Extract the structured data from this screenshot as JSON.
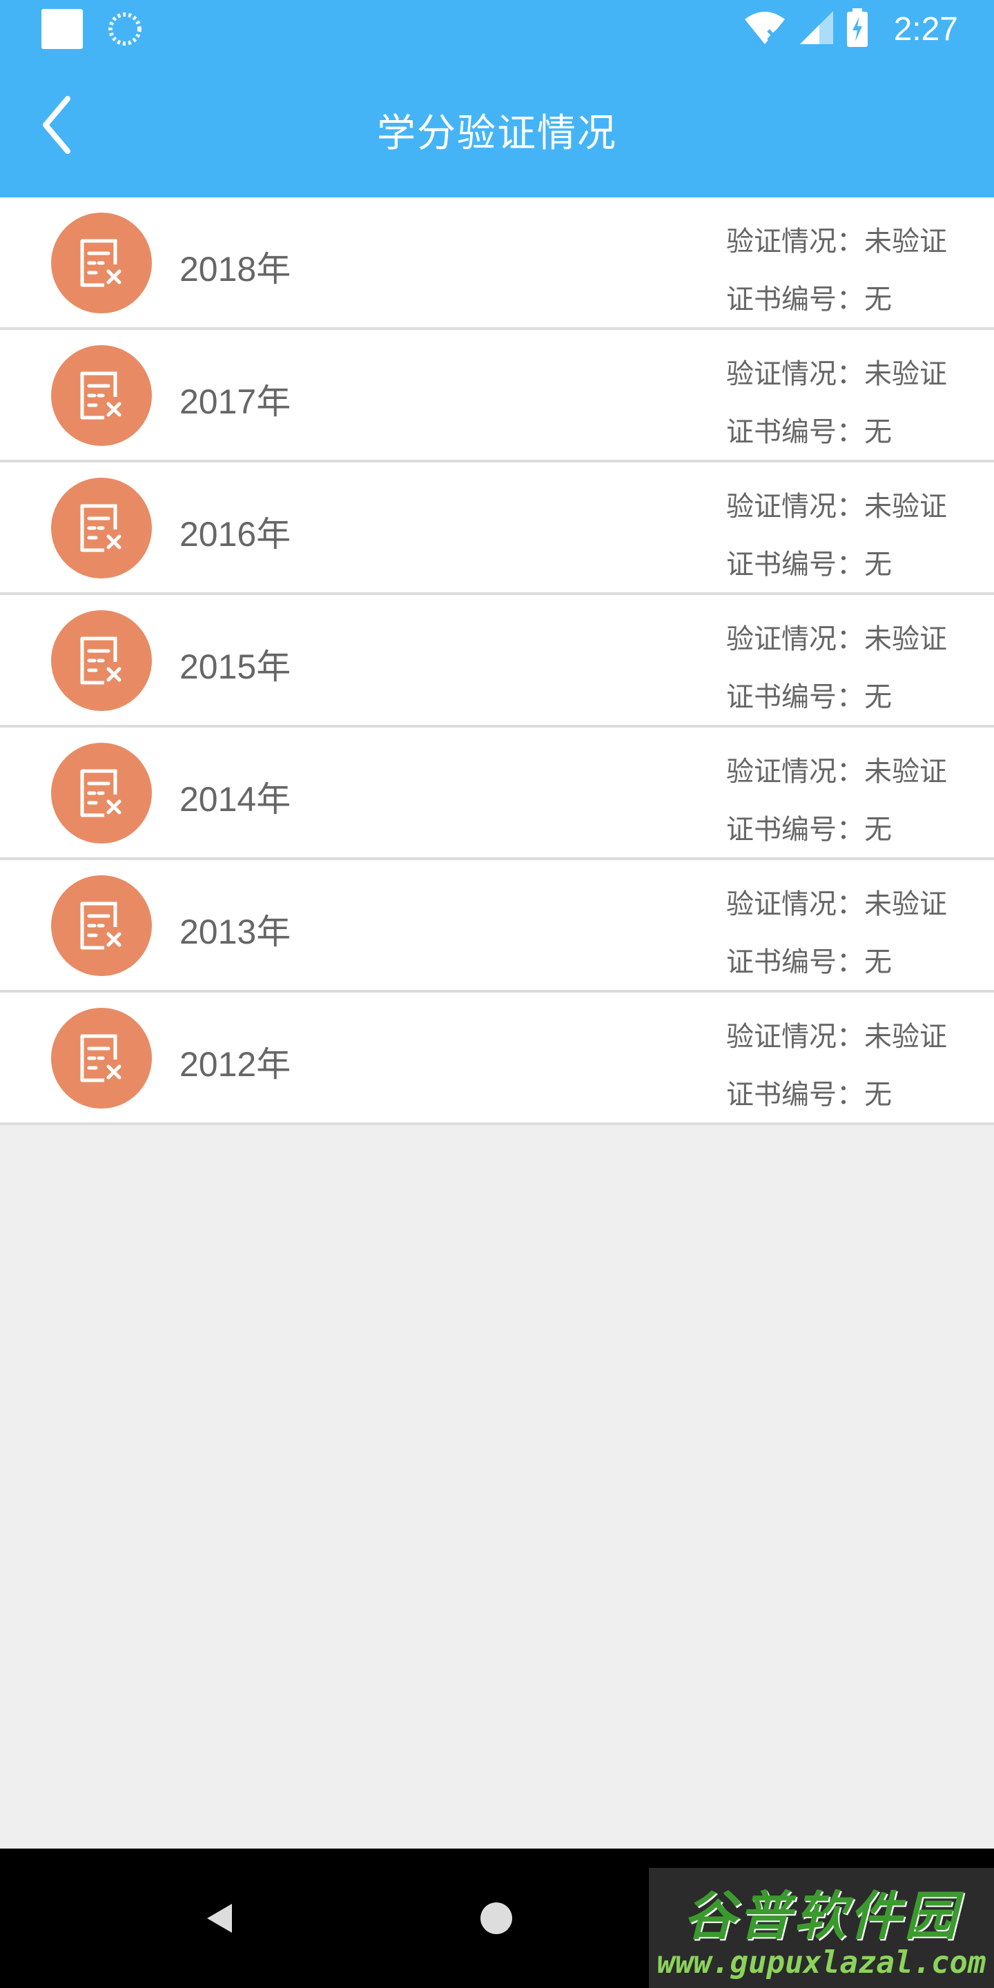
{
  "status_bar": {
    "time": "2:27",
    "icons": [
      "notification-square-icon",
      "loading-icon",
      "wifi-off-icon",
      "cell-signal-icon",
      "battery-charging-icon"
    ]
  },
  "header": {
    "title": "学分验证情况",
    "back_icon": "chevron-left-icon"
  },
  "records": [
    {
      "year": "2018年",
      "status_label": "验证情况：",
      "status_value": "未验证",
      "cert_label": "证书编号：",
      "cert_value": "无"
    },
    {
      "year": "2017年",
      "status_label": "验证情况：",
      "status_value": "未验证",
      "cert_label": "证书编号：",
      "cert_value": "无"
    },
    {
      "year": "2016年",
      "status_label": "验证情况：",
      "status_value": "未验证",
      "cert_label": "证书编号：",
      "cert_value": "无"
    },
    {
      "year": "2015年",
      "status_label": "验证情况：",
      "status_value": "未验证",
      "cert_label": "证书编号：",
      "cert_value": "无"
    },
    {
      "year": "2014年",
      "status_label": "验证情况：",
      "status_value": "未验证",
      "cert_label": "证书编号：",
      "cert_value": "无"
    },
    {
      "year": "2013年",
      "status_label": "验证情况：",
      "status_value": "未验证",
      "cert_label": "证书编号：",
      "cert_value": "无"
    },
    {
      "year": "2012年",
      "status_label": "验证情况：",
      "status_value": "未验证",
      "cert_label": "证书编号：",
      "cert_value": "无"
    }
  ],
  "colors": {
    "header": "#45b4f7",
    "icon_circle": "#e88b64",
    "background": "#efefef"
  },
  "watermark": {
    "line1": "谷普软件园",
    "line2": "www.gupuxlazal.com"
  }
}
